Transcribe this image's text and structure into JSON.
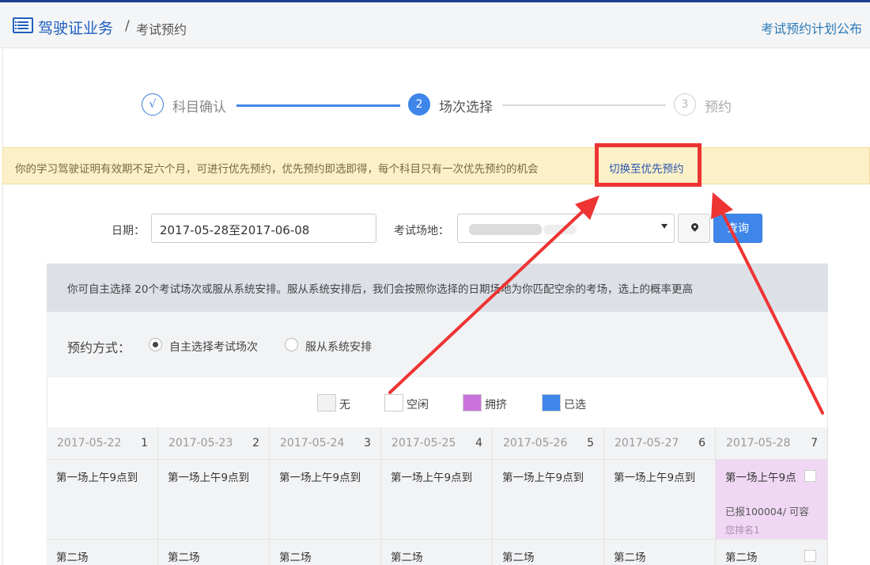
{
  "header": {
    "title": "驾驶证业务",
    "separator": "/",
    "subtitle": "考试预约",
    "right_link": "考试预约计划公布"
  },
  "steps": [
    {
      "icon": "√",
      "label": "科目确认"
    },
    {
      "icon": "2",
      "label": "场次选择"
    },
    {
      "icon": "3",
      "label": "预约"
    }
  ],
  "notice": {
    "text": "你的学习驾驶证明有效期不足六个月，可进行优先预约，优先预约即选即得，每个科目只有一次优先预约的机会",
    "link": "切换至优先预约"
  },
  "search": {
    "date_label": "日期：",
    "date_value": "2017-05-28至2017-06-08",
    "site_label": "考试场地：",
    "query_button": "查询"
  },
  "info_text": "你可自主选择 20个考试场次或服从系统安排。服从系统安排后，我们会按照你选择的日期场地为你匹配空余的考场，选上的概率更高",
  "mode": {
    "label": "预约方式：",
    "options": [
      "自主选择考试场次",
      "服从系统安排"
    ],
    "selected": 0
  },
  "legend": [
    {
      "label": "无",
      "color": "#f2f2f2"
    },
    {
      "label": "空闲",
      "color": "#ffffff"
    },
    {
      "label": "拥挤",
      "color": "#c972da"
    },
    {
      "label": "已选",
      "color": "#3f86ea"
    }
  ],
  "schedule": {
    "days": [
      {
        "date": "2017-05-22",
        "num": "1"
      },
      {
        "date": "2017-05-23",
        "num": "2"
      },
      {
        "date": "2017-05-24",
        "num": "3"
      },
      {
        "date": "2017-05-25",
        "num": "4"
      },
      {
        "date": "2017-05-26",
        "num": "5"
      },
      {
        "date": "2017-05-27",
        "num": "6"
      },
      {
        "date": "2017-05-28",
        "num": "7"
      }
    ],
    "session1_label": "第一场上午9点到",
    "session1_label_last": "第一场上午9点",
    "session1_last_registered": "已报100004/ 可容",
    "session1_last_rank": "您排名1",
    "session2_label": "第二场"
  }
}
